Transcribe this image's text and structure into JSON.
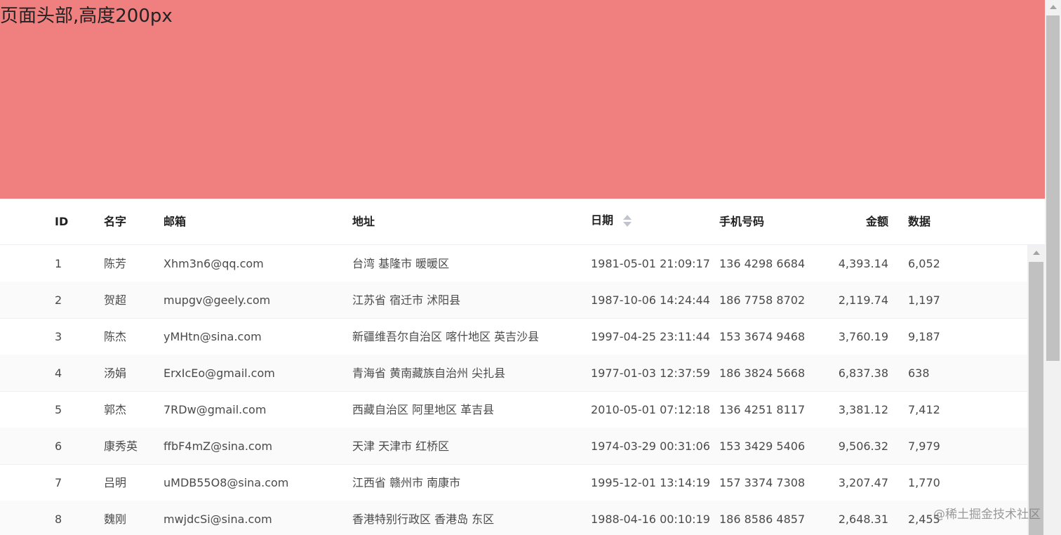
{
  "header": {
    "text": "页面头部,高度200px",
    "background": "#f08080"
  },
  "table": {
    "columns": [
      {
        "key": "id",
        "label": "ID"
      },
      {
        "key": "name",
        "label": "名字"
      },
      {
        "key": "email",
        "label": "邮箱"
      },
      {
        "key": "address",
        "label": "地址"
      },
      {
        "key": "date",
        "label": "日期",
        "sortable": true
      },
      {
        "key": "phone",
        "label": "手机号码"
      },
      {
        "key": "amount",
        "label": "金额"
      },
      {
        "key": "data",
        "label": "数据"
      }
    ],
    "rows": [
      {
        "id": "1",
        "name": "陈芳",
        "email": "Xhm3n6@qq.com",
        "address": "台湾 基隆市 暖暖区",
        "date": "1981-05-01 21:09:17",
        "phone": "136 4298 6684",
        "amount": "4,393.14",
        "data": "6,052"
      },
      {
        "id": "2",
        "name": "贺超",
        "email": "mupgv@geely.com",
        "address": "江苏省 宿迁市 沭阳县",
        "date": "1987-10-06 14:24:44",
        "phone": "186 7758 8702",
        "amount": "2,119.74",
        "data": "1,197"
      },
      {
        "id": "3",
        "name": "陈杰",
        "email": "yMHtn@sina.com",
        "address": "新疆维吾尔自治区 喀什地区 英吉沙县",
        "date": "1997-04-25 23:11:44",
        "phone": "153 3674 9468",
        "amount": "3,760.19",
        "data": "9,187"
      },
      {
        "id": "4",
        "name": "汤娟",
        "email": "ErxIcEo@gmail.com",
        "address": "青海省 黄南藏族自治州 尖扎县",
        "date": "1977-01-03 12:37:59",
        "phone": "186 3824 5668",
        "amount": "6,837.38",
        "data": "638"
      },
      {
        "id": "5",
        "name": "郭杰",
        "email": "7RDw@gmail.com",
        "address": "西藏自治区 阿里地区 革吉县",
        "date": "2010-05-01 07:12:18",
        "phone": "136 4251 8117",
        "amount": "3,381.12",
        "data": "7,412"
      },
      {
        "id": "6",
        "name": "康秀英",
        "email": "ffbF4mZ@sina.com",
        "address": "天津 天津市 红桥区",
        "date": "1974-03-29 00:31:06",
        "phone": "153 3429 5406",
        "amount": "9,506.32",
        "data": "7,979"
      },
      {
        "id": "7",
        "name": "吕明",
        "email": "uMDB55O8@sina.com",
        "address": "江西省 赣州市 南康市",
        "date": "1995-12-01 13:14:19",
        "phone": "157 3374 7308",
        "amount": "3,207.47",
        "data": "1,770"
      },
      {
        "id": "8",
        "name": "魏刚",
        "email": "mwjdcSi@sina.com",
        "address": "香港特别行政区 香港岛 东区",
        "date": "1988-04-16 00:10:19",
        "phone": "186 8586 4857",
        "amount": "2,648.31",
        "data": "2,455"
      }
    ]
  },
  "watermark": "@稀土掘金技术社区"
}
